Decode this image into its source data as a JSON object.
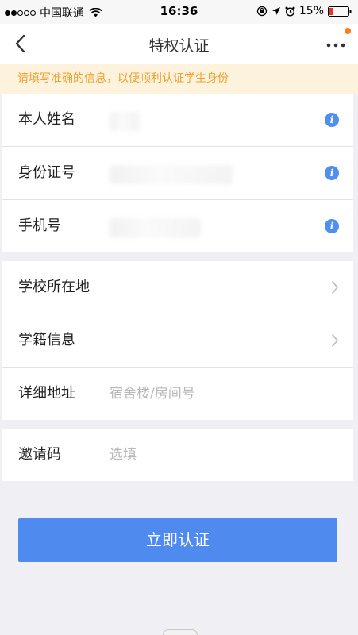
{
  "status_bar": {
    "carrier": "中国联通",
    "time": "16:36",
    "battery": "15%"
  },
  "nav": {
    "title": "特权认证",
    "icons": [
      "back-arrow-icon",
      "more-icon"
    ]
  },
  "notice": "请填写准确的信息，以便顺利认证学生身份",
  "personal_info": [
    {
      "label": "本人姓名",
      "icon": "info-icon"
    },
    {
      "label": "身份证号",
      "icon": "info-icon"
    },
    {
      "label": "手机号",
      "icon": "info-icon"
    }
  ],
  "school_info": [
    {
      "label": "学校所在地",
      "icon": "chevron-right-icon"
    },
    {
      "label": "学籍信息",
      "icon": "chevron-right-icon"
    },
    {
      "label": "详细地址",
      "placeholder": "宿舍楼/房间号"
    }
  ],
  "invite": {
    "label": "邀请码",
    "placeholder": "选填"
  },
  "submit_label": "立即认证",
  "colors": {
    "primary": "#4f8bef",
    "notice_bg": "#fdf3dd",
    "notice_text": "#f0a030",
    "badge": "#ff7a1a"
  },
  "info_glyph": "i"
}
